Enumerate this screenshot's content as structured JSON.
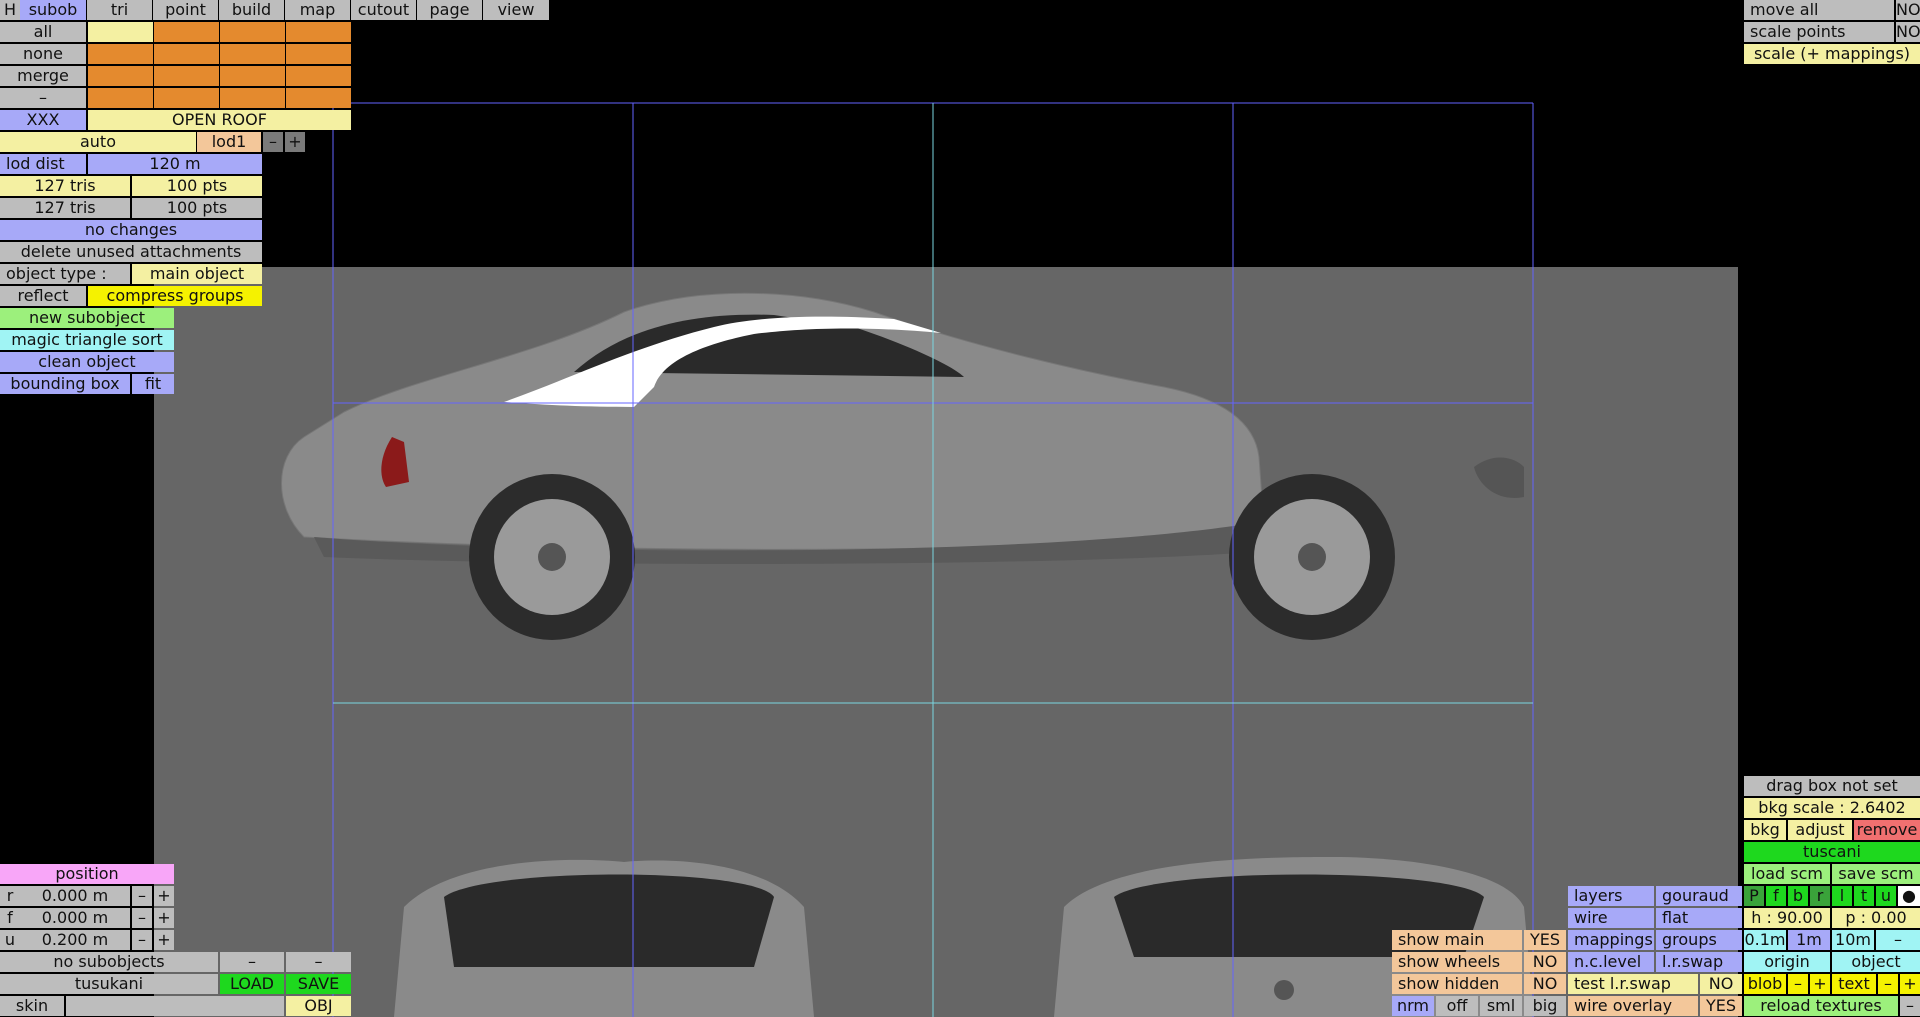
{
  "menu": {
    "h": "H",
    "tabs": [
      "subob",
      "tri",
      "point",
      "build",
      "map",
      "cutout",
      "page",
      "view"
    ]
  },
  "left": {
    "select": [
      "all",
      "none",
      "merge",
      "–"
    ],
    "name_code": "XXX",
    "name": "OPEN ROOF",
    "auto": "auto",
    "lod": "lod1",
    "minus": "–",
    "plus": "+",
    "lod_dist_label": "lod dist",
    "lod_dist_val": "120 m",
    "tris1": "127 tris",
    "pts1": "100 pts",
    "tris2": "127 tris",
    "pts2": "100 pts",
    "no_changes": "no changes",
    "delete_unused": "delete unused attachments",
    "object_type_label": "object type :",
    "object_type_val": "main object",
    "reflect": "reflect",
    "compress": "compress groups",
    "new_subobject": "new subobject",
    "magic_sort": "magic triangle sort",
    "clean_object": "clean object",
    "bounding_box": "bounding box",
    "fit": "fit"
  },
  "position": {
    "title": "position",
    "rows": [
      {
        "axis": "r",
        "value": "0.000 m"
      },
      {
        "axis": "f",
        "value": "0.000 m"
      },
      {
        "axis": "u",
        "value": "0.200 m"
      }
    ]
  },
  "bottom_left": {
    "no_subobjects": "no subobjects",
    "dash1": "–",
    "dash2": "–",
    "model_name": "tusukani",
    "load": "LOAD",
    "save": "SAVE",
    "skin": "skin",
    "obj": "OBJ"
  },
  "top_right": {
    "move_all": "move all",
    "move_all_val": "NO",
    "scale_points": "scale points",
    "scale_points_val": "NO",
    "scale_mappings": "scale (+ mappings)"
  },
  "bkg": {
    "drag_box": "drag box not set",
    "bkg_scale": "bkg scale : 2.6402",
    "bkg": "bkg",
    "adjust": "adjust",
    "remove": "remove",
    "car_name": "tuscani",
    "load_scm": "load scm",
    "save_scm": "save scm",
    "view_letters": [
      "P",
      "f",
      "b",
      "r",
      "l",
      "t",
      "u",
      "●"
    ],
    "h": "h : 90.00",
    "p": "p : 0.00",
    "grid": [
      "0.1m",
      "1m",
      "10m",
      "–"
    ],
    "origin": "origin",
    "object": "object",
    "blob": "blob",
    "text": "text",
    "reload": "reload textures",
    "minus": "–",
    "plus": "+"
  },
  "render": {
    "layers": "layers",
    "gouraud": "gouraud",
    "wire": "wire",
    "flat": "flat",
    "mappings": "mappings",
    "groups": "groups",
    "nc_level": "n.c.level",
    "lr_swap": "l.r.swap",
    "test_lr_swap": "test l.r.swap",
    "test_lr_val": "NO",
    "wire_overlay": "wire overlay",
    "wire_overlay_val": "YES"
  },
  "show": {
    "main": "show main",
    "main_val": "YES",
    "wheels": "show wheels",
    "wheels_val": "NO",
    "hidden": "show hidden",
    "hidden_val": "NO",
    "sizes": [
      "nrm",
      "off",
      "sml",
      "big"
    ]
  },
  "colors": {
    "viewport": "#666666",
    "grid_line": "#6464ff",
    "highlight": "#ffffff"
  }
}
